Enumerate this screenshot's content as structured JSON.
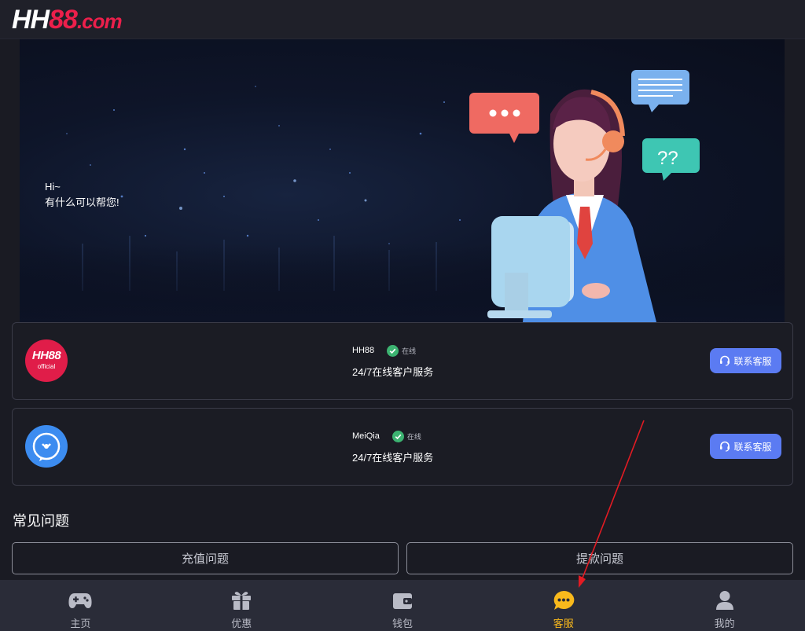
{
  "header": {
    "logo_hh": "HH",
    "logo_num": "88",
    "logo_domain": ".com"
  },
  "banner": {
    "greeting_line1": "Hi~",
    "greeting_line2": "有什么可以帮您!"
  },
  "services": [
    {
      "name": "HH88",
      "status": "在线",
      "description": "24/7在线客户服务",
      "button": "联系客服",
      "avatar_text": "HH88",
      "avatar_sub": "official"
    },
    {
      "name": "MeiQia",
      "status": "在线",
      "description": "24/7在线客户服务",
      "button": "联系客服"
    }
  ],
  "faq": {
    "title": "常见问题",
    "items": [
      "充值问题",
      "提款问题"
    ]
  },
  "bottom_nav": [
    {
      "label": "主页",
      "icon": "gamepad-icon"
    },
    {
      "label": "优惠",
      "icon": "gift-icon"
    },
    {
      "label": "钱包",
      "icon": "wallet-icon"
    },
    {
      "label": "客服",
      "icon": "chat-icon",
      "active": true
    },
    {
      "label": "我的",
      "icon": "user-icon"
    }
  ],
  "colors": {
    "accent": "#5b7bf2",
    "brand": "#ec1f4b",
    "active": "#f8b91c",
    "online": "#3cb371",
    "background": "#1a1b23"
  }
}
